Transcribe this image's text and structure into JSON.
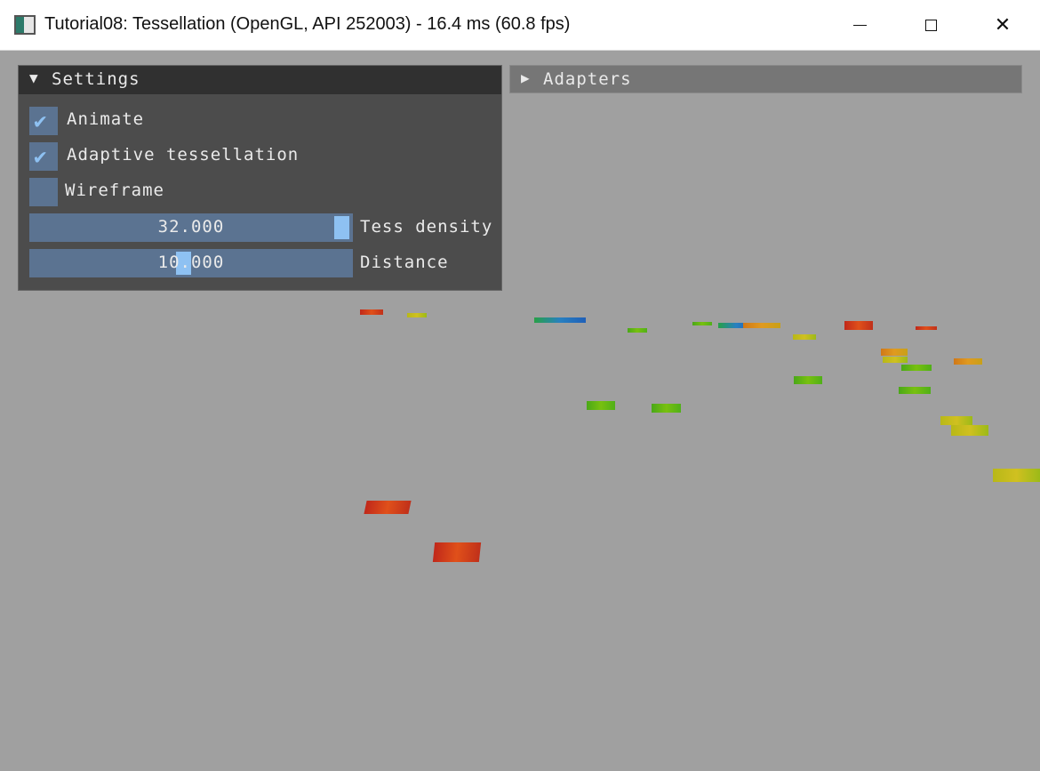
{
  "window": {
    "title": "Tutorial08: Tessellation (OpenGL, API 252003) - 16.4 ms (60.8 fps)",
    "controls": [
      "minimize-icon",
      "maximize-icon",
      "close-icon"
    ]
  },
  "settings_panel": {
    "title": "Settings",
    "expanded": true,
    "checkboxes": [
      {
        "label": "Animate",
        "checked": true
      },
      {
        "label": "Adaptive tessellation",
        "checked": true
      },
      {
        "label": "Wireframe",
        "checked": false
      }
    ],
    "sliders": [
      {
        "label": "Tess density",
        "value": "32.000"
      },
      {
        "label": "Distance",
        "value": "10.000"
      }
    ]
  },
  "adapters_panel": {
    "title": "Adapters",
    "expanded": false
  },
  "colors": {
    "background": "#a0a0a0",
    "widget": "#5b7391",
    "accent": "#8ec1f2",
    "header": "#303030"
  }
}
